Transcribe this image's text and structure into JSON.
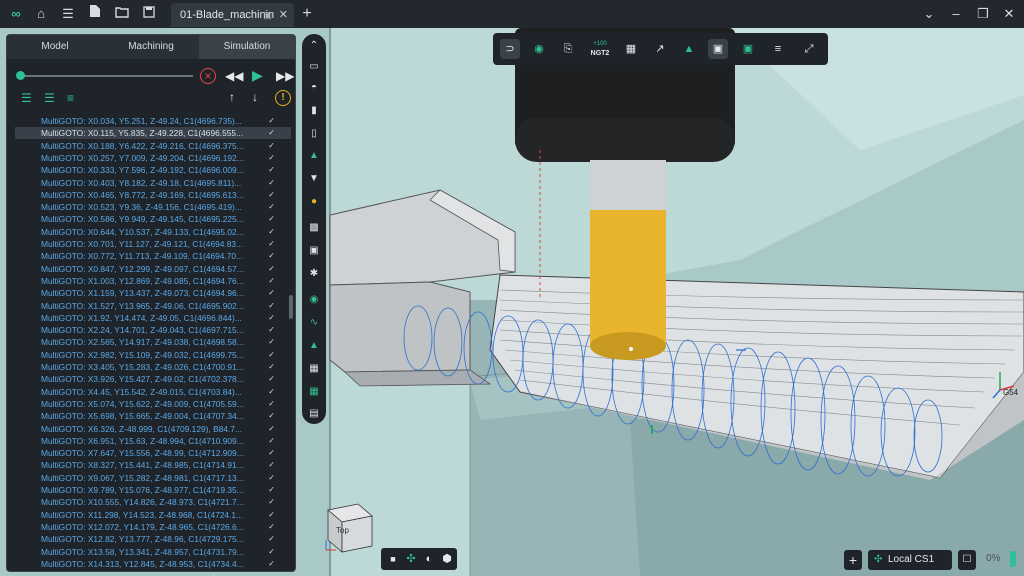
{
  "titlebar": {
    "tab_title": "01-Blade_machinin",
    "icons": [
      "logo-icon",
      "home-icon",
      "menu-icon",
      "new-file-icon",
      "open-folder-icon",
      "save-icon",
      "monitor-icon",
      "close-icon",
      "plus-icon",
      "chevron-down-icon",
      "minimize-icon",
      "restore-icon",
      "window-close-icon"
    ]
  },
  "panel": {
    "tabs": [
      "Model",
      "Machining",
      "Simulation"
    ],
    "active_tab": "Simulation",
    "program_lines": [
      "MultiGOTO: X0.034, Y5.251, Z-49.24, C1(4696.735)...",
      "MultiGOTO: X0.115, Y5.835, Z-49.228, C1(4696.555...",
      "MultiGOTO: X0.188, Y6.422, Z-49.216, C1(4696.375...",
      "MultiGOTO: X0.257, Y7.009, Z-49.204, C1(4696.192...",
      "MultiGOTO: X0.333, Y7.596, Z-49.192, C1(4696.009...",
      "MultiGOTO: X0.403, Y8.182, Z-49.18, C1(4695.811)...",
      "MultiGOTO: X0.465, Y8.772, Z-49.169, C1(4695.613...",
      "MultiGOTO: X0.523, Y9.36, Z-49.156, C1(4695.419)...",
      "MultiGOTO: X0.586, Y9.949, Z-49.145, C1(4695.225...",
      "MultiGOTO: X0.644, Y10.537, Z-49.133, C1(4695.02...",
      "MultiGOTO: X0.701, Y11.127, Z-49.121, C1(4694.83...",
      "MultiGOTO: X0.772, Y11.713, Z-49.109, C1(4694.70...",
      "MultiGOTO: X0.847, Y12.299, Z-49.097, C1(4694.57...",
      "MultiGOTO: X1.003, Y12.869, Z-49.085, C1(4694.76...",
      "MultiGOTO: X1.159, Y13.437, Z-49.073, C1(4694.96...",
      "MultiGOTO: X1.527, Y13.965, Z-49.06, C1(4695.902...",
      "MultiGOTO: X1.92, Y14.474, Z-49.05, C1(4696.844)...",
      "MultiGOTO: X2.24, Y14.701, Z-49.043, C1(4697.715...",
      "MultiGOTO: X2.565, Y14.917, Z-49.038, C1(4698.58...",
      "MultiGOTO: X2.982, Y15.109, Z-49.032, C1(4699.75...",
      "MultiGOTO: X3.405, Y15.283, Z-49.026, C1(4700.91...",
      "MultiGOTO: X3.926, Y15.427, Z-49.02, C1(4702.378...",
      "MultiGOTO: X4.45, Y15.542, Z-49.015, C1(4703.84)...",
      "MultiGOTO: X5.074, Y15.622, Z-49.009, C1(4705.59...",
      "MultiGOTO: X5.698, Y15.665, Z-49.004, C1(4707.34...",
      "MultiGOTO: X6.326, Z-48.999, C1(4709.129), B84.7...",
      "MultiGOTO: X6.951, Y15.63, Z-48.994, C1(4710.909...",
      "MultiGOTO: X7.647, Y15.556, Z-48.99, C1(4712.909...",
      "MultiGOTO: X8.327, Y15.441, Z-48.985, C1(4714.91...",
      "MultiGOTO: X9.067, Y15.282, Z-48.981, C1(4717.13...",
      "MultiGOTO: X9.789, Y15.076, Z-48.977, C1(4719.35...",
      "MultiGOTO: X10.555, Y14.826, Z-48.973, C1(4721.7...",
      "MultiGOTO: X11.298, Y14.523, Z-48.968, C1(4724.1...",
      "MultiGOTO: X12.072, Y14.179, Z-48.965, C1(4726.6...",
      "MultiGOTO: X12.82, Y13.777, Z-48.96, C1(4729.175...",
      "MultiGOTO: X13.58, Y13.341, Z-48.957, C1(4731.79...",
      "MultiGOTO: X14.313, Y12.845, Z-48.953, C1(4734.4..."
    ],
    "selected_line_index": 1,
    "playback_progress": 0.02
  },
  "viewport": {
    "toolbar_label_top": "+100",
    "toolbar_label_bottom": "NGT2",
    "cs_marker": "G54",
    "viewcube_face": "Top",
    "cs_name": "Local CS1",
    "progress_text": "0%"
  },
  "colors": {
    "accent": "#2fbf9a",
    "program_text": "#5ba9e6",
    "tool_yellow": "#e8b42b",
    "toolpath_blue": "#2f6fd1"
  }
}
